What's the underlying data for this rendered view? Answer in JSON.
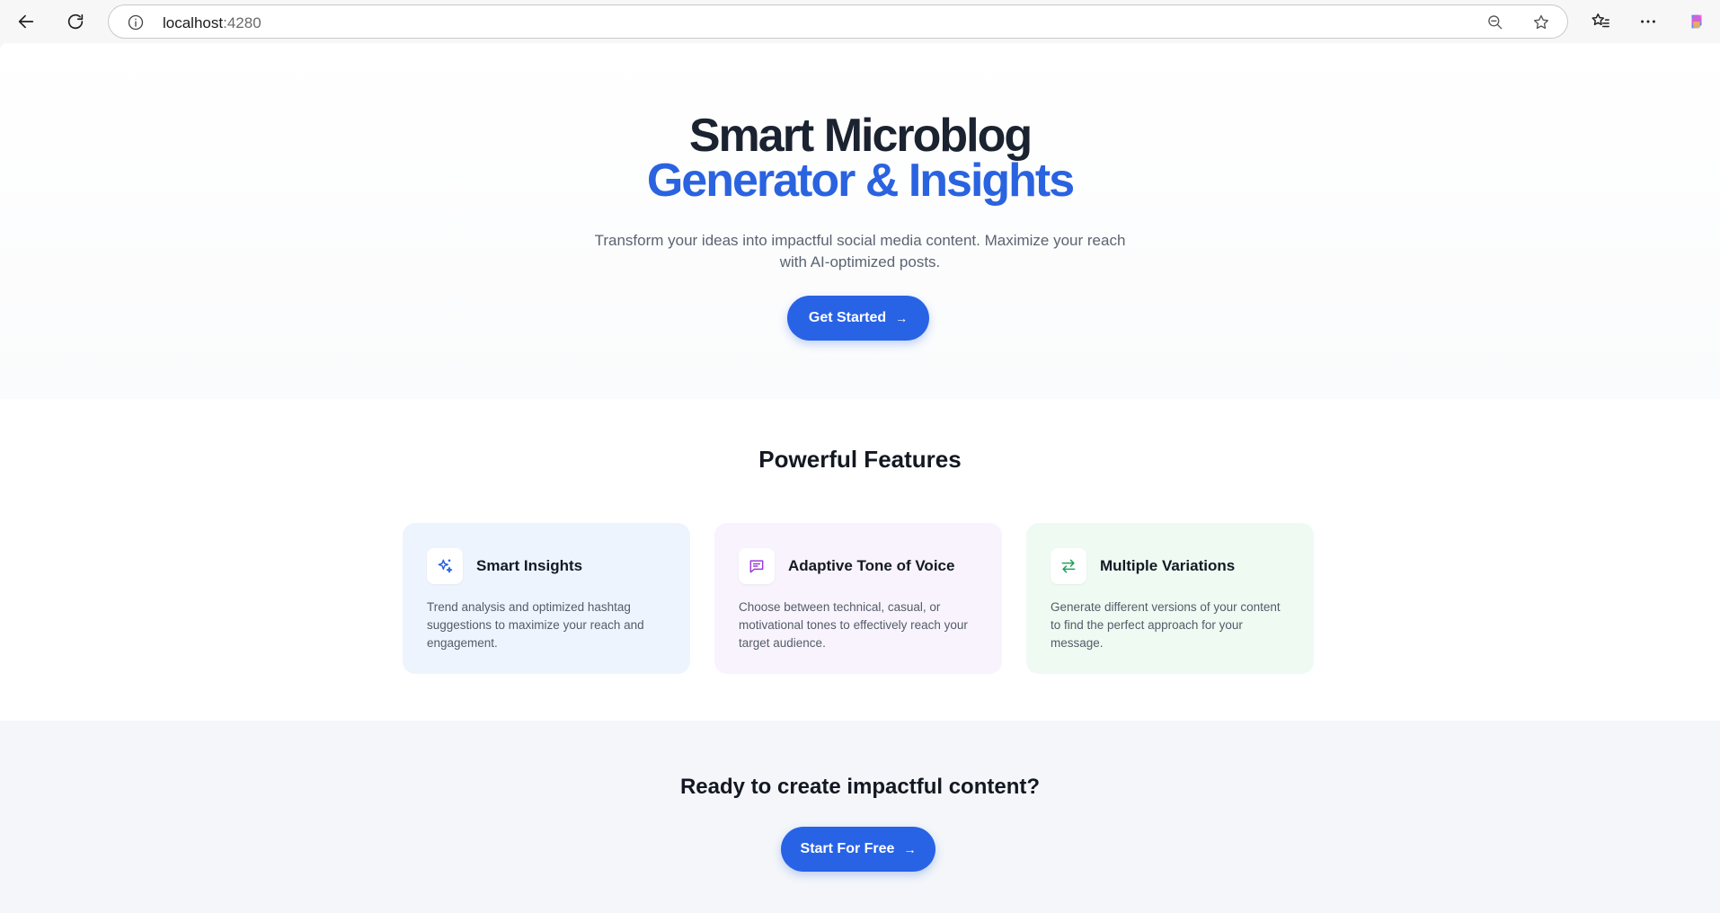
{
  "browser": {
    "url_host": "localhost",
    "url_port": ":4280"
  },
  "hero": {
    "title_line1": "Smart Microblog",
    "title_line2": "Generator & Insights",
    "subtitle": "Transform your ideas into impactful social media content. Maximize your reach with AI-optimized posts.",
    "cta_label": "Get Started",
    "cta_arrow": "→"
  },
  "features": {
    "title": "Powerful Features",
    "cards": [
      {
        "title": "Smart Insights",
        "description": "Trend analysis and optimized hashtag suggestions to maximize your reach and engagement.",
        "icon": "sparkles-icon",
        "bg": "#eef4fe",
        "icon_color": "#2a63e0"
      },
      {
        "title": "Adaptive Tone of Voice",
        "description": "Choose between technical, casual, or motivational tones to effectively reach your target audience.",
        "icon": "message-icon",
        "bg": "#f8f3fd",
        "icon_color": "#9b3ed8"
      },
      {
        "title": "Multiple Variations",
        "description": "Generate different versions of your content to find the perfect approach for your message.",
        "icon": "swap-arrows-icon",
        "bg": "#eefaf2",
        "icon_color": "#22a05a"
      }
    ]
  },
  "cta": {
    "title": "Ready to create impactful content?",
    "button_label": "Start For Free",
    "button_arrow": "→"
  },
  "colors": {
    "accent": "#2863e6",
    "heading": "#1b2230"
  }
}
